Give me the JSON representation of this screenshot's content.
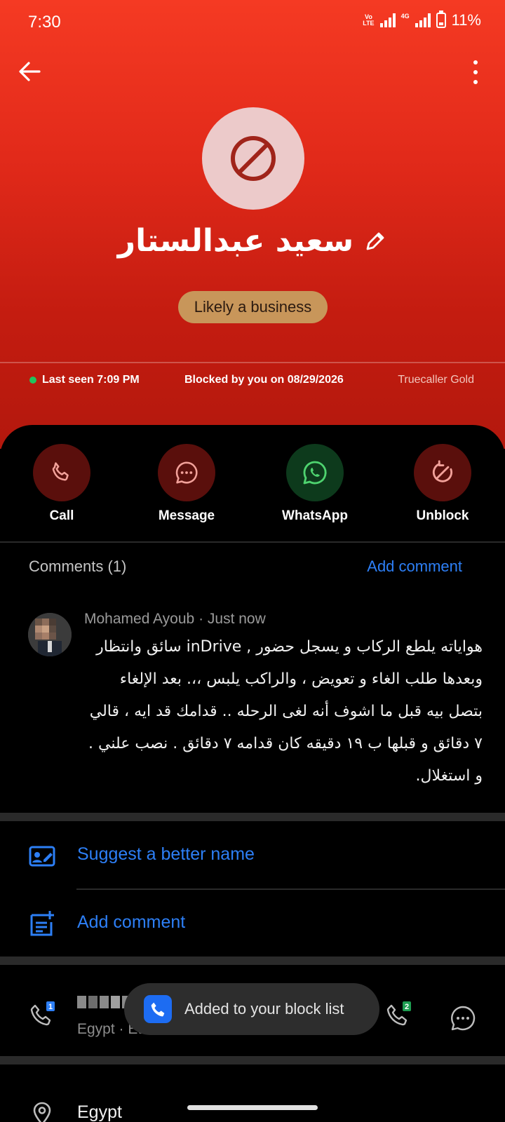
{
  "status_bar": {
    "time": "7:30",
    "volte": "Vo LTE",
    "network": "4G",
    "battery": "11%"
  },
  "header": {
    "back_icon": "arrow-left-icon",
    "more_icon": "more-vertical-icon"
  },
  "contact": {
    "avatar_icon": "blocked-icon",
    "name": "سعيد عبدالستار",
    "edit_icon": "pencil-icon",
    "tag": "Likely a business",
    "last_seen": "Last seen 7:09 PM",
    "blocked": "Blocked by you on 08/29/2026",
    "membership": "Truecaller Gold"
  },
  "actions": [
    {
      "label": "Call",
      "icon": "phone-icon"
    },
    {
      "label": "Message",
      "icon": "message-icon"
    },
    {
      "label": "WhatsApp",
      "icon": "whatsapp-icon"
    },
    {
      "label": "Unblock",
      "icon": "unblock-icon"
    }
  ],
  "comments": {
    "title": "Comments (1)",
    "add_link": "Add comment",
    "items": [
      {
        "author": "Mohamed Ayoub",
        "time": "Just now",
        "text": "هواياته يلطع الركاب و يسجل حضور , inDrive سائق وانتظار وبعدها طلب الغاء و تعويض ، والراكب يلبس ،،. بعد الإلغاء بتصل بيه قبل ما اشوف أنه لغى الرحله .. قدامك قد ايه ، قالي ٧ دقائق و قبلها ب ١٩ دقيقه كان قدامه ٧ دقائق . نصب علني . و استغلال."
      }
    ]
  },
  "options": {
    "suggest_name": "Suggest a better name",
    "add_comment": "Add comment"
  },
  "phone": {
    "sub": "Egypt · Etisalat",
    "sim1": "1",
    "sim2": "2"
  },
  "toast": {
    "message": "Added to your block list"
  },
  "location": {
    "label": "Egypt"
  },
  "colors": {
    "accent_blue": "#2d7ff6",
    "hero_red": "#e22a1a",
    "tag_gold": "#c8965a"
  }
}
